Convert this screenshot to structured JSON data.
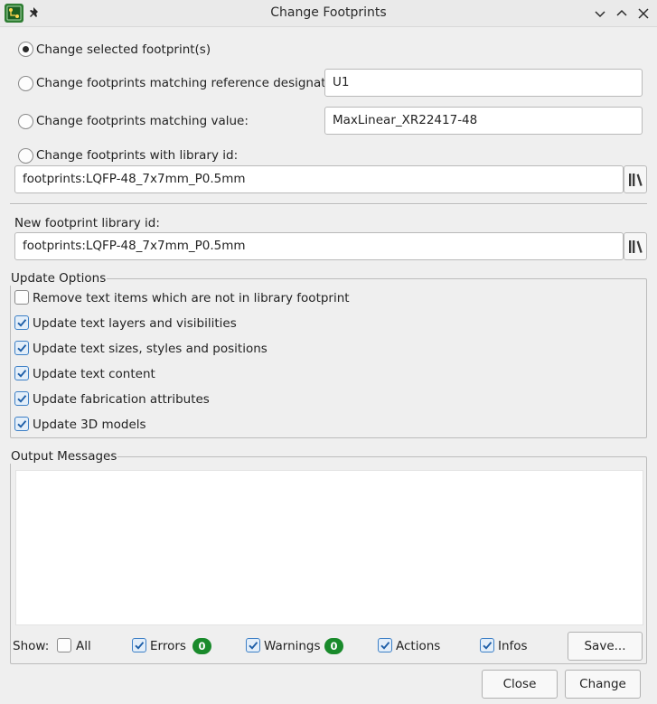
{
  "window": {
    "title": "Change Footprints",
    "icons": [
      "app-icon",
      "pin-icon",
      "minimize-icon",
      "maximize-icon",
      "close-icon"
    ]
  },
  "mode": {
    "selected_label": "Change selected footprint(s)",
    "ref_label": "Change footprints matching reference designator:",
    "ref_value": "U1",
    "value_label": "Change footprints matching value:",
    "value_value": "MaxLinear_XR22417-48",
    "libid_label": "Change footprints with library id:",
    "libid_value": "footprints:LQFP-48_7x7mm_P0.5mm",
    "selected_option": "Change selected footprint(s)"
  },
  "new_footprint": {
    "label": "New footprint library id:",
    "value": "footprints:LQFP-48_7x7mm_P0.5mm"
  },
  "update_options": {
    "title": "Update Options",
    "items": [
      {
        "label": "Remove text items which are not in library footprint",
        "checked": false
      },
      {
        "label": "Update text layers and visibilities",
        "checked": true
      },
      {
        "label": "Update text sizes, styles and positions",
        "checked": true
      },
      {
        "label": "Update text content",
        "checked": true
      },
      {
        "label": "Update fabrication attributes",
        "checked": true
      },
      {
        "label": "Update 3D models",
        "checked": true
      }
    ]
  },
  "output": {
    "title": "Output Messages",
    "show_label": "Show:",
    "filters": [
      {
        "label": "All",
        "checked": false
      },
      {
        "label": "Errors",
        "checked": true,
        "count": "0"
      },
      {
        "label": "Warnings",
        "checked": true,
        "count": "0"
      },
      {
        "label": "Actions",
        "checked": true
      },
      {
        "label": "Infos",
        "checked": true
      }
    ],
    "save_label": "Save..."
  },
  "buttons": {
    "close_label": "Close",
    "change_label": "Change"
  },
  "colors": {
    "badge": "#198a2b",
    "checkbox_accent": "#3c7fc6"
  }
}
